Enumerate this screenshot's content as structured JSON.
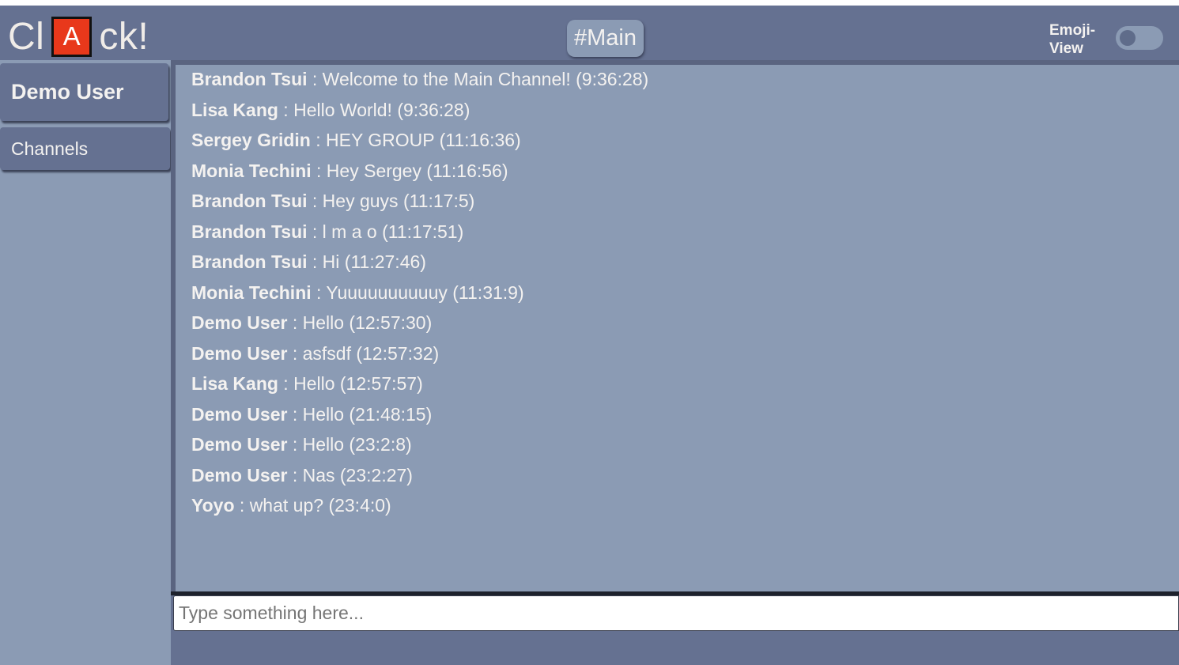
{
  "header": {
    "logo": {
      "prefix": "Cl",
      "boxed": "A",
      "suffix": "ck!"
    },
    "channel": "#Main",
    "emoji_toggle": {
      "label": "Emoji-View",
      "enabled": false
    }
  },
  "sidebar": {
    "user_name": "Demo User",
    "channels_label": "Channels"
  },
  "messages": [
    {
      "user": "Brandon Tsui",
      "text": " : Welcome to the Main Channel! (9:36:28)"
    },
    {
      "user": "Lisa Kang",
      "text": " : Hello World! (9:36:28)"
    },
    {
      "user": "Sergey Gridin",
      "text": " : HEY GROUP (11:16:36)"
    },
    {
      "user": "Monia Techini",
      "text": " : Hey Sergey (11:16:56)"
    },
    {
      "user": "Brandon Tsui",
      "text": " : Hey guys (11:17:5)"
    },
    {
      "user": "Brandon Tsui",
      "text": " : l m a o (11:17:51)"
    },
    {
      "user": "Brandon Tsui",
      "text": " : Hi (11:27:46)"
    },
    {
      "user": "Monia Techini",
      "text": " : Yuuuuuuuuuuy (11:31:9)"
    },
    {
      "user": "Demo User",
      "text": " : Hello (12:57:30)"
    },
    {
      "user": "Demo User",
      "text": " : asfsdf (12:57:32)"
    },
    {
      "user": "Lisa Kang",
      "text": " : Hello (12:57:57)"
    },
    {
      "user": "Demo User",
      "text": " : Hello (21:48:15)"
    },
    {
      "user": "Demo User",
      "text": " : Hello (23:2:8)"
    },
    {
      "user": "Demo User",
      "text": " : Nas (23:2:27)"
    },
    {
      "user": "Yoyo",
      "text": " : what up? (23:4:0)"
    }
  ],
  "composer": {
    "value": "",
    "placeholder": "Type something here..."
  }
}
